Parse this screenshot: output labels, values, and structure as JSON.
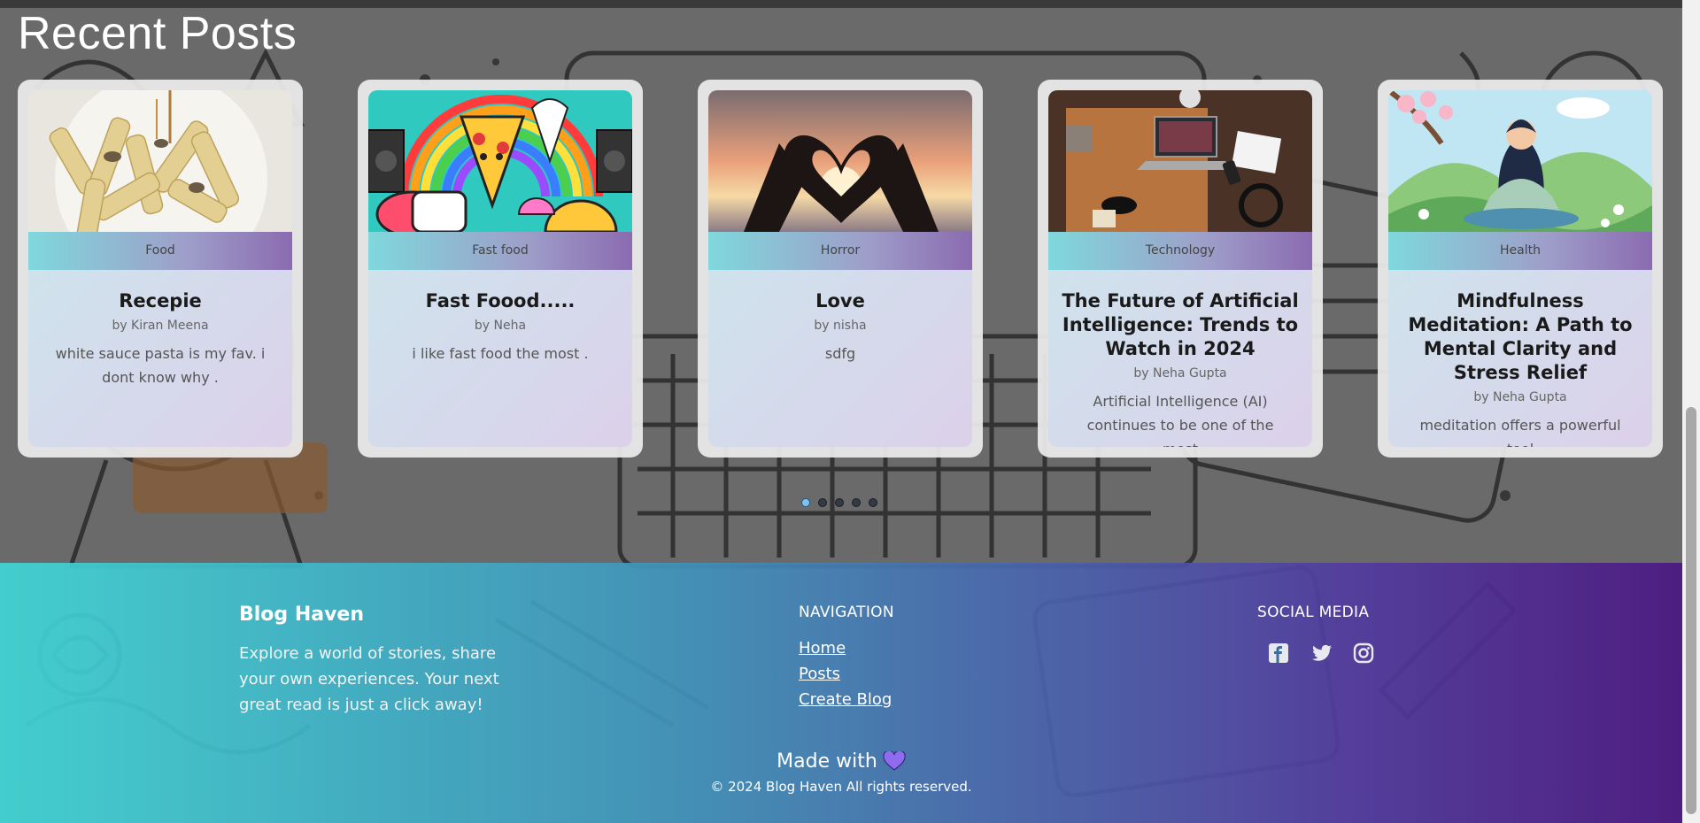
{
  "page": {
    "section_title": "Recent Posts"
  },
  "posts": [
    {
      "category": "Food",
      "title": "Recepie",
      "author": "by Kiran Meena",
      "excerpt": "white sauce pasta is my fav. i dont know why ."
    },
    {
      "category": "Fast food",
      "title": "Fast Foood.....",
      "author": "by Neha",
      "excerpt": "i like fast food the most ."
    },
    {
      "category": "Horror",
      "title": "Love",
      "author": "by nisha",
      "excerpt": "sdfg"
    },
    {
      "category": "Technology",
      "title": "The Future of Artificial Intelligence: Trends to Watch in 2024",
      "author": "by Neha Gupta",
      "excerpt": "Artificial Intelligence (AI) continues to be one of the most"
    },
    {
      "category": "Health",
      "title": "Mindfulness Meditation: A Path to Mental Clarity and Stress Relief",
      "author": "by Neha Gupta",
      "excerpt": "meditation offers a powerful tool"
    }
  ],
  "carousel": {
    "pages": 5,
    "active_page": 1
  },
  "footer": {
    "brand_title": "Blog Haven",
    "brand_desc": "Explore a world of stories, share your own experiences. Your next great read is just a click away!",
    "nav_title": "NAVIGATION",
    "nav_links": [
      "Home",
      "Posts",
      "Create Blog"
    ],
    "social_title": "SOCIAL MEDIA",
    "social_icons": [
      "facebook-icon",
      "twitter-icon",
      "instagram-icon"
    ],
    "made_with": "Made with",
    "copyright": "© 2024 Blog Haven All rights reserved."
  },
  "colors": {
    "footer_gradient_start": "#40d6d6",
    "footer_gradient_end": "#4c1a82",
    "heart": "#8e6cf0",
    "active_dot": "#7fc3f2"
  }
}
